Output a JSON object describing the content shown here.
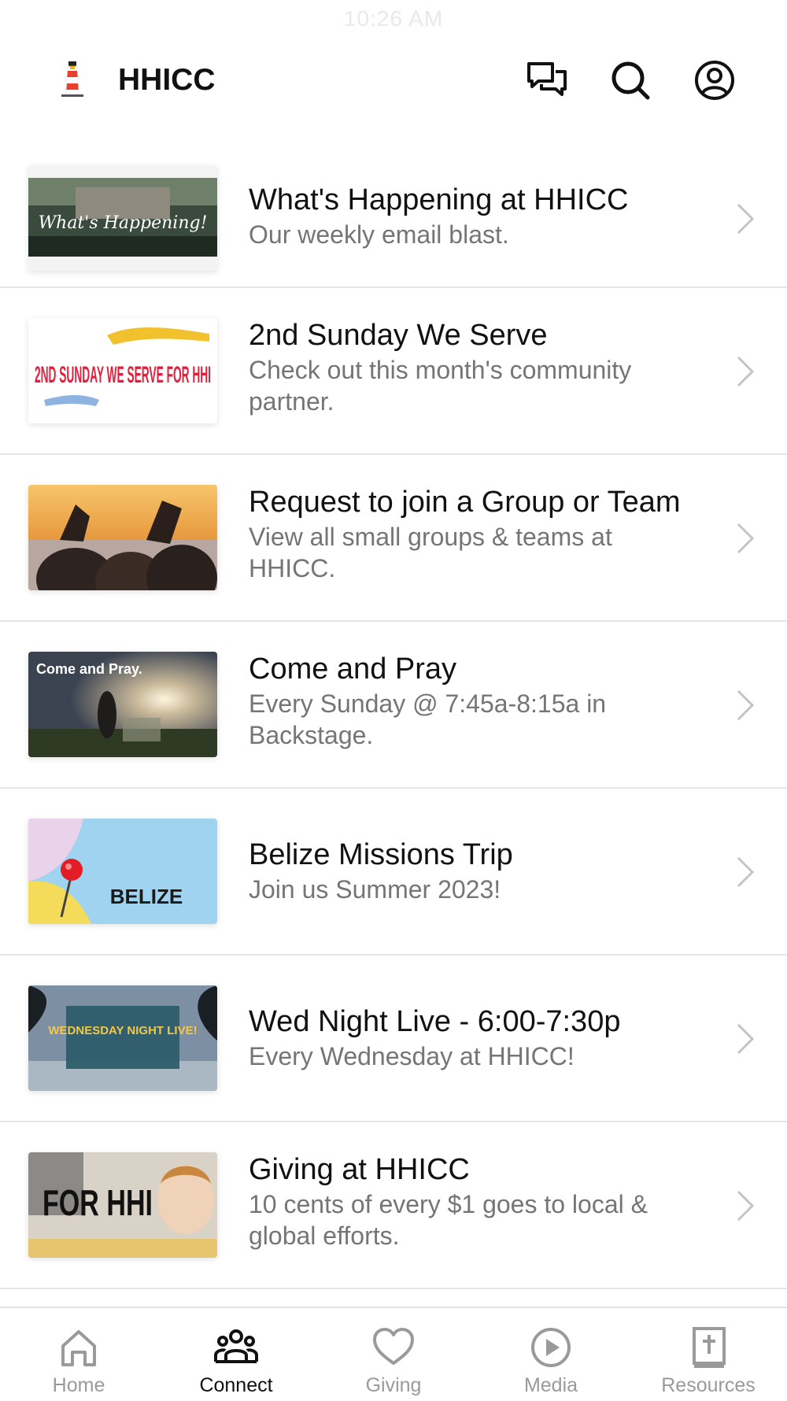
{
  "status_bar": {
    "time": "10:26 AM"
  },
  "header": {
    "title": "HHICC"
  },
  "items": [
    {
      "title": "What's Happening at HHICC",
      "subtitle": "Our weekly email blast.",
      "thumb_text": "What's Happening!"
    },
    {
      "title": "2nd Sunday We Serve",
      "subtitle": "Check out this month's community partner.",
      "thumb_text": "2ND SUNDAY WE SERVE FOR HHI"
    },
    {
      "title": "Request to join a Group or Team",
      "subtitle": "View all small groups & teams at HHICC.",
      "thumb_text": ""
    },
    {
      "title": "Come and Pray",
      "subtitle": "Every Sunday @ 7:45a-8:15a in Backstage.",
      "thumb_text": "Come and Pray."
    },
    {
      "title": "Belize Missions Trip",
      "subtitle": "Join us Summer 2023!",
      "thumb_text": "BELIZE"
    },
    {
      "title": "Wed Night Live - 6:00-7:30p",
      "subtitle": "Every Wednesday at HHICC!",
      "thumb_text": "WEDNESDAY NIGHT LIVE!"
    },
    {
      "title": "Giving at HHICC",
      "subtitle": "10 cents of every $1 goes to local & global efforts.",
      "thumb_text": "FOR HHI"
    }
  ],
  "tabs": [
    {
      "label": "Home",
      "icon": "home-icon",
      "active": false
    },
    {
      "label": "Connect",
      "icon": "people-icon",
      "active": true
    },
    {
      "label": "Giving",
      "icon": "heart-icon",
      "active": false
    },
    {
      "label": "Media",
      "icon": "play-icon",
      "active": false
    },
    {
      "label": "Resources",
      "icon": "bible-icon",
      "active": false
    }
  ],
  "colors": {
    "active_tab": "#111111",
    "inactive_tab": "#9a9a9a",
    "subtitle": "#757575",
    "divider": "#e6e6e6"
  }
}
